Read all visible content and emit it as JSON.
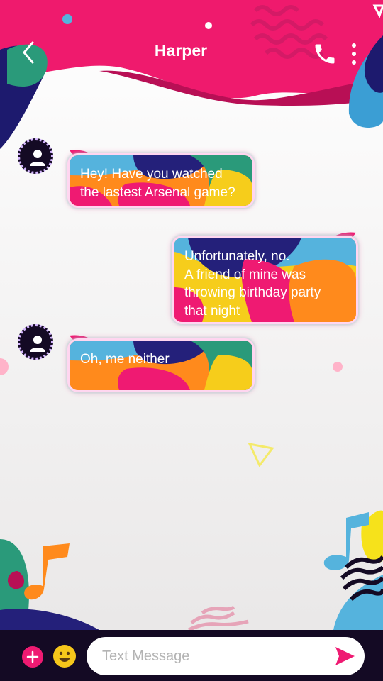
{
  "header": {
    "title": "Harper",
    "back_icon": "chevron-left-icon",
    "call_icon": "phone-icon",
    "menu_icon": "more-vertical-icon"
  },
  "messages": [
    {
      "direction": "incoming",
      "text": "Hey! Have you watched\nthe lastest Arsenal game?"
    },
    {
      "direction": "outgoing",
      "text": "Unfortunately, no.\nA friend of mine was\nthrowing birthday party\nthat night"
    },
    {
      "direction": "incoming",
      "text": "Oh, me neither"
    }
  ],
  "composer": {
    "placeholder": "Text Message",
    "add_icon": "plus-icon",
    "emoji_icon": "smiley-icon",
    "send_icon": "send-icon"
  },
  "colors": {
    "brand_pink": "#ef1a72",
    "dark_bar": "#140a24",
    "bubble_orange": "#ff8a1c",
    "bubble_blue": "#55b3dd",
    "bubble_navy": "#24207a",
    "bubble_yellow": "#f6cd1b"
  }
}
